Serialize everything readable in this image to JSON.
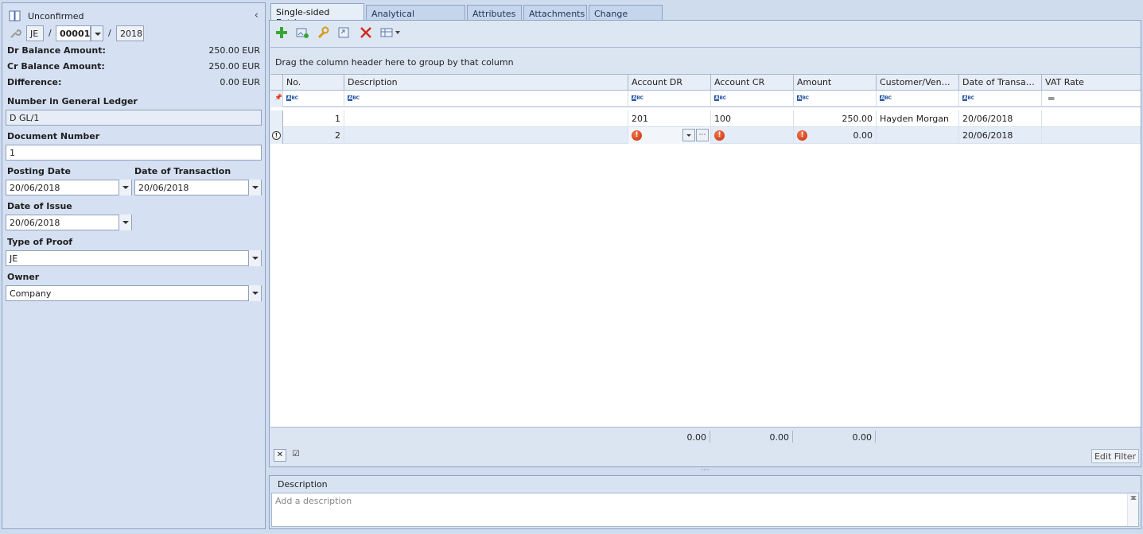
{
  "header": {
    "status": "Unconfirmed",
    "doc_type": "JE",
    "doc_number": "00001",
    "doc_year": "2018",
    "sep1": "/",
    "sep2": "/"
  },
  "balances": {
    "dr_label": "Dr Balance Amount:",
    "dr_value": "250.00 EUR",
    "cr_label": "Cr Balance Amount:",
    "cr_value": "250.00 EUR",
    "diff_label": "Difference:",
    "diff_value": "0.00 EUR"
  },
  "fields": {
    "gl_label": "Number in General Ledger",
    "gl_value": "D GL/1",
    "docnum_label": "Document Number",
    "docnum_value": "1",
    "posting_label": "Posting Date",
    "posting_value": "20/06/2018",
    "transaction_label": "Date of Transaction",
    "transaction_value": "20/06/2018",
    "issue_label": "Date of Issue",
    "issue_value": "20/06/2018",
    "proof_label": "Type of Proof",
    "proof_value": "JE",
    "owner_label": "Owner",
    "owner_value": "Company"
  },
  "tabs": [
    {
      "label": "Single-sided Entries"
    },
    {
      "label": "Analytical Description"
    },
    {
      "label": "Attributes"
    },
    {
      "label": "Attachments"
    },
    {
      "label": "Change History"
    }
  ],
  "grid": {
    "group_hint": "Drag the column header here to group by that column",
    "columns": [
      "No.",
      "Description",
      "Account DR",
      "Account CR",
      "Amount",
      "Customer/Vendor",
      "Date of Transacti...",
      "VAT Rate"
    ],
    "rows": [
      {
        "no": "1",
        "description": "",
        "account_dr": "201",
        "account_cr": "100",
        "amount": "250.00",
        "customer": "Hayden Morgan",
        "date": "20/06/2018",
        "vat": ""
      },
      {
        "no": "2",
        "description": "",
        "account_dr": "",
        "account_cr": "",
        "amount": "0.00",
        "customer": "",
        "date": "20/06/2018",
        "vat": ""
      }
    ],
    "totals": {
      "account_dr": "0.00",
      "account_cr": "0.00",
      "amount": "0.00"
    },
    "edit_filter": "Edit Filter"
  },
  "description": {
    "title": "Description",
    "placeholder": "Add a description"
  }
}
